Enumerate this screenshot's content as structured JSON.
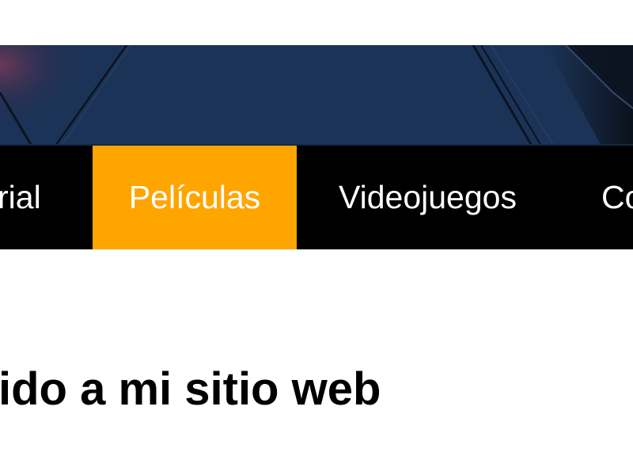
{
  "nav": {
    "items": [
      {
        "label": "rial",
        "active": false
      },
      {
        "label": "Películas",
        "active": true
      },
      {
        "label": "Videojuegos",
        "active": false
      },
      {
        "label": "Co",
        "active": false
      }
    ]
  },
  "main": {
    "heading": "ido a mi sitio web"
  },
  "colors": {
    "nav_background": "#000000",
    "nav_active": "#ffa500",
    "nav_text": "#ffffff",
    "hero_base": "#1c3458"
  },
  "hero": {
    "icon": "hero-banner-image"
  }
}
